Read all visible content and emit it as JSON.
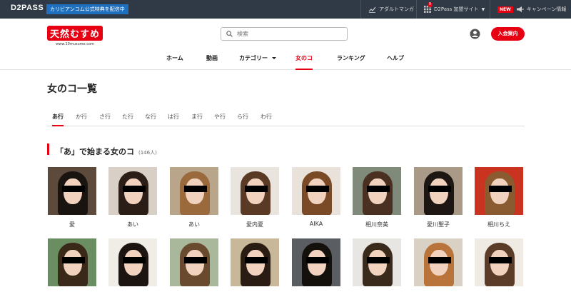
{
  "topbar": {
    "logo": "D2PASS",
    "promo": "カリビアンコム公式特典を配信中",
    "adult_manga": "アダルトマンガ",
    "d2pass_sites": "D2Pass 加盟サイト",
    "d2pass_badge": "9",
    "new_badge": "NEW",
    "campaign": "キャンペーン情報"
  },
  "header": {
    "brand": "天然むすめ",
    "brand_url": "www.10musume.com",
    "search_placeholder": "検索",
    "join_label": "入会案内"
  },
  "nav": [
    {
      "label": "ホーム",
      "active": false
    },
    {
      "label": "動画",
      "active": false
    },
    {
      "label": "カテゴリー",
      "active": false,
      "dropdown": true
    },
    {
      "label": "女のコ",
      "active": true
    },
    {
      "label": "ランキング",
      "active": false
    },
    {
      "label": "ヘルプ",
      "active": false
    }
  ],
  "page_title": "女のコ一覧",
  "tabs": [
    {
      "label": "あ行",
      "active": true
    },
    {
      "label": "か行"
    },
    {
      "label": "さ行"
    },
    {
      "label": "た行"
    },
    {
      "label": "な行"
    },
    {
      "label": "は行"
    },
    {
      "label": "ま行"
    },
    {
      "label": "や行"
    },
    {
      "label": "ら行"
    },
    {
      "label": "わ行"
    }
  ],
  "section": {
    "title": "「あ」で始まる女のコ",
    "count": "(146人)"
  },
  "girls": [
    {
      "name": "愛",
      "hair": "#1a1410",
      "bg": "#5c4a3c"
    },
    {
      "name": "あい",
      "hair": "#2a1e16",
      "bg": "#d8d0c6"
    },
    {
      "name": "あい",
      "hair": "#9a6a3c",
      "bg": "#b9a58a"
    },
    {
      "name": "愛内夏",
      "hair": "#5a3a24",
      "bg": "#e9e4de"
    },
    {
      "name": "AIKA",
      "hair": "#7a4a26",
      "bg": "#e8e2da"
    },
    {
      "name": "相川奈美",
      "hair": "#4a3020",
      "bg": "#7f8a7a"
    },
    {
      "name": "愛川聖子",
      "hair": "#1e1612",
      "bg": "#a89a86"
    },
    {
      "name": "相川ちえ",
      "hair": "#8a5a30",
      "bg": "#c9331f"
    },
    {
      "name": "",
      "hair": "#3a2818",
      "bg": "#6a8e62"
    },
    {
      "name": "",
      "hair": "#1c1410",
      "bg": "#f0ece6"
    },
    {
      "name": "",
      "hair": "#6a4a2e",
      "bg": "#a9b89a"
    },
    {
      "name": "",
      "hair": "#2a1c12",
      "bg": "#c9b79a"
    },
    {
      "name": "",
      "hair": "#14100c",
      "bg": "#5a5e62"
    },
    {
      "name": "",
      "hair": "#3a2a1c",
      "bg": "#e8e6e2"
    },
    {
      "name": "",
      "hair": "#b8743a",
      "bg": "#d9d2c4"
    },
    {
      "name": "",
      "hair": "#5a3c28",
      "bg": "#efeae4"
    }
  ]
}
